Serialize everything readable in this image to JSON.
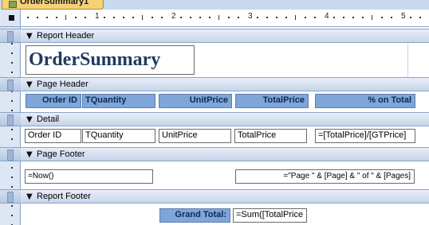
{
  "tab": {
    "title": "OrderSummary1"
  },
  "ruler": {
    "numbers": [
      "1",
      "2",
      "3",
      "4",
      "5"
    ]
  },
  "sections": {
    "report_header": "Report Header",
    "page_header": "Page Header",
    "detail": "Detail",
    "page_footer": "Page Footer",
    "report_footer": "Report Footer"
  },
  "report_title": "OrderSummary",
  "page_header_labels": {
    "order_id": "Order ID",
    "tquantity": "TQuantity",
    "unit_price": "UnitPrice",
    "total_price": "TotalPrice",
    "pct_total": "% on Total"
  },
  "detail_fields": {
    "order_id": "Order ID",
    "tquantity": "TQuantity",
    "unit_price": "UnitPrice",
    "total_price": "TotalPrice",
    "pct_total": "=[TotalPrice]/[GTPrice]"
  },
  "page_footer": {
    "now": "=Now()",
    "page_expr": "=\"Page \" & [Page] & \" of \" & [Pages]"
  },
  "report_footer": {
    "grand_total_label": "Grand Total:",
    "grand_total_expr": "=Sum([TotalPrice"
  },
  "colors": {
    "label_fill": "#7ea6d8",
    "band_fill": "#c7d5ea",
    "title_text": "#1f3b60"
  }
}
